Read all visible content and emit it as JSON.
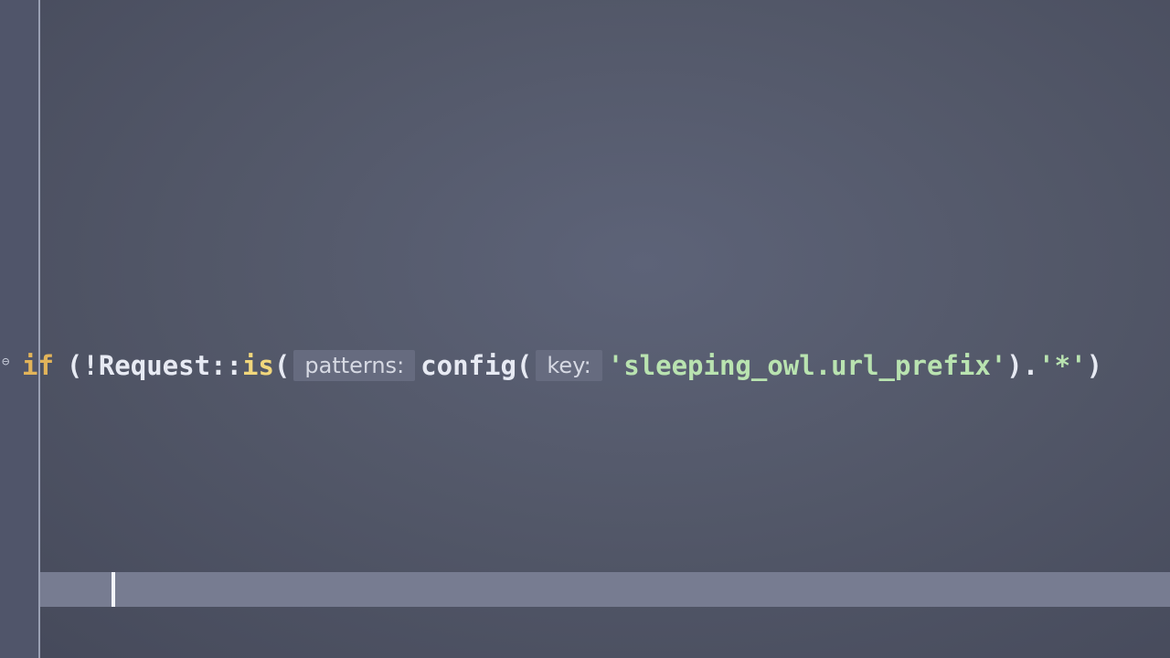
{
  "editor": {
    "code": {
      "kw_if": "if",
      "open_not": "(!",
      "class_name": "Request",
      "double_colon": "::",
      "method_is": "is",
      "paren_open_1": "(",
      "hint_patterns": "patterns:",
      "func_config": "config",
      "paren_open_2": "(",
      "hint_key": "key:",
      "string_1": "'sleeping_owl.url_prefix'",
      "close_paren_dot": ").",
      "string_2": "'*'",
      "close_paren_2": ")"
    },
    "fold_icon": "fold-minus-icon",
    "colors": {
      "background": "#535869",
      "keyword": "#e2b45a",
      "string": "#b9e3b0",
      "hint_bg": "#666b7f",
      "current_line": "#777c91"
    }
  }
}
